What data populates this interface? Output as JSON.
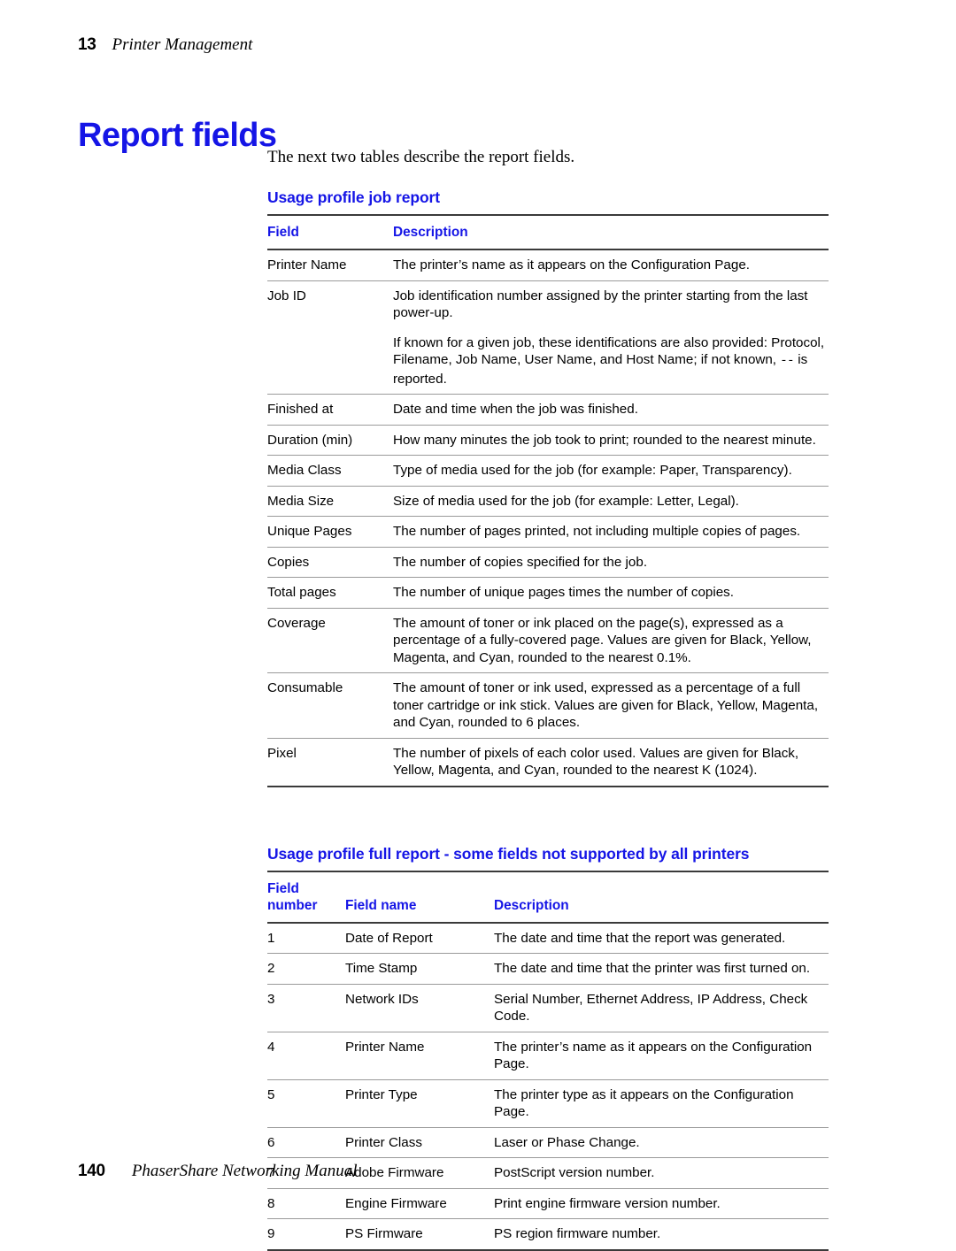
{
  "colors": {
    "accent_blue": "#1515e6",
    "rule_dark": "#3a3a3a",
    "rule_light": "#9a9a9a",
    "text": "#000000",
    "page_background": "#ffffff"
  },
  "running_head": {
    "chapter_number": "13",
    "chapter_title": "Printer Management"
  },
  "page_title": "Report fields",
  "intro_paragraph": "The next two tables describe the report fields.",
  "job_report": {
    "title": "Usage profile job report",
    "columns": [
      "Field",
      "Description"
    ],
    "rows": [
      {
        "field": "Printer Name",
        "description": "The printer’s name as it appears on the Configuration Page."
      },
      {
        "field": "Job ID",
        "description": "Job identification number assigned by the printer starting from the last power-up."
      },
      {
        "field": "",
        "description_part1": "If known for a given job, these identifications are also provided: Protocol, Filename, Job Name, User Name, and Host Name; if not known, ",
        "description_dash": "--",
        "description_part2": " is reported."
      },
      {
        "field": "Finished at",
        "description": "Date and time when the job was finished."
      },
      {
        "field": "Duration (min)",
        "description": "How many minutes the job took to print; rounded to the nearest minute."
      },
      {
        "field": "Media Class",
        "description": "Type of media used for the job (for example: Paper, Transparency)."
      },
      {
        "field": "Media Size",
        "description": "Size of media used for the job (for example: Letter, Legal)."
      },
      {
        "field": "Unique Pages",
        "description": "The number of pages printed, not including multiple copies of pages."
      },
      {
        "field": "Copies",
        "description": "The number of copies specified for the job."
      },
      {
        "field": "Total pages",
        "description": "The number of unique pages times the number of copies."
      },
      {
        "field": "Coverage",
        "description": "The amount of toner or ink placed on the page(s), expressed as a percentage of a fully-covered page. Values are given for Black, Yellow, Magenta, and Cyan, rounded to the nearest 0.1%."
      },
      {
        "field": "Consumable",
        "description": "The amount of toner or ink used, expressed as a percentage of a full toner cartridge or ink stick. Values are given for Black, Yellow, Magenta, and Cyan, rounded to 6 places."
      },
      {
        "field": "Pixel",
        "description": "The number of pixels of each color used.  Values are given for Black, Yellow, Magenta, and Cyan, rounded to the nearest K (1024)."
      }
    ]
  },
  "full_report": {
    "title": "Usage profile full report - some fields not supported by all printers",
    "columns": [
      "Field number",
      "Field name",
      "Description"
    ],
    "columns_wrapped": {
      "number_line1": "Field",
      "number_line2": "number",
      "name": "Field name",
      "description": "Description"
    },
    "rows": [
      {
        "number": "1",
        "name": "Date of Report",
        "description": "The date and time that the report was generated."
      },
      {
        "number": "2",
        "name": "Time Stamp",
        "description": "The date and time that the printer was first turned on."
      },
      {
        "number": "3",
        "name": "Network IDs",
        "description": "Serial Number, Ethernet Address, IP Address, Check Code."
      },
      {
        "number": "4",
        "name": "Printer Name",
        "description": "The printer’s name as it appears on the Configuration Page."
      },
      {
        "number": "5",
        "name": "Printer Type",
        "description": "The printer type as it appears on the Configuration Page."
      },
      {
        "number": "6",
        "name": "Printer Class",
        "description": "Laser or Phase Change."
      },
      {
        "number": "7",
        "name": "Adobe Firmware",
        "description": "PostScript version number."
      },
      {
        "number": "8",
        "name": "Engine Firmware",
        "description": "Print engine firmware version number."
      },
      {
        "number": "9",
        "name": "PS Firmware",
        "description": "PS region firmware number."
      }
    ]
  },
  "footer": {
    "page_number": "140",
    "manual_title": "PhaserShare Networking Manual"
  }
}
